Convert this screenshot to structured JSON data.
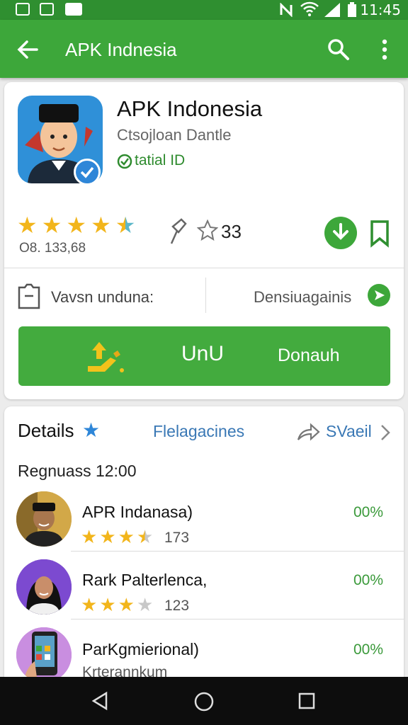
{
  "status_bar": {
    "time": "11:45"
  },
  "app_bar": {
    "title": "APK Indnesia"
  },
  "app": {
    "name": "APK Indonesia",
    "developer": "Ctsojloan Dantle",
    "tag": "tatial ID",
    "rating_count": "O8. 133,68",
    "stat_value": "33",
    "stars": [
      1,
      1,
      1,
      1,
      0.5
    ]
  },
  "info_row": {
    "left_label": "Vavsn unduna:",
    "right_label": "Densiuagainis"
  },
  "primary_button": {
    "label_left": "UnU",
    "label_right": "Donauh"
  },
  "details": {
    "title": "Details",
    "link_label": "Flelagacines",
    "share_label": "SVaeil",
    "section_time": "Regnuass 12:00",
    "items": [
      {
        "name": "APR Indanasa)",
        "pct": "00%",
        "count": "173",
        "stars": [
          1,
          1,
          1,
          0.5
        ]
      },
      {
        "name": "Rark Palterlenca,",
        "pct": "00%",
        "count": "123",
        "stars": [
          1,
          1,
          1,
          0
        ]
      },
      {
        "name": "ParKgmierional)",
        "pct": "00%",
        "subtitle": "Krterannkum"
      }
    ]
  },
  "colors": {
    "primary_green": "#3da73a",
    "star_gold": "#f2b51b",
    "link_blue": "#3a78b5"
  }
}
